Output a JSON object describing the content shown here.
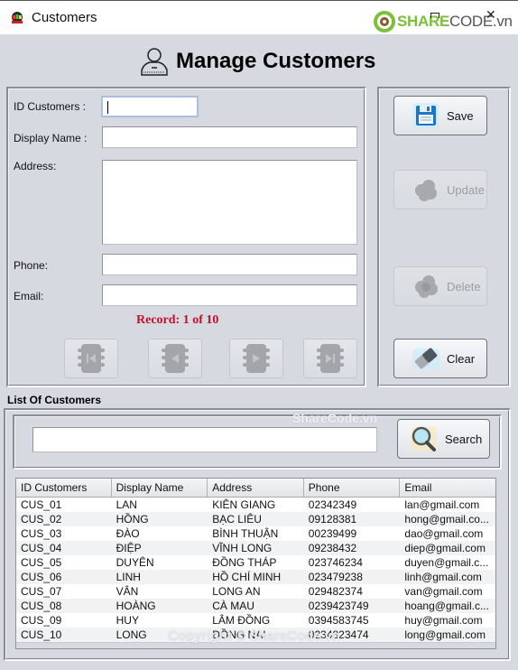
{
  "window": {
    "title": "Customers",
    "brand_share": "SHARE",
    "brand_code": "CODE.vn",
    "close_glyph": "✕"
  },
  "header": {
    "title": "Manage Customers",
    "icon": "user-icon"
  },
  "form": {
    "id_label": "ID Customers :",
    "id_value": "",
    "name_label": "Display Name :",
    "name_value": "",
    "address_label": "Address:",
    "address_value": "",
    "phone_label": "Phone:",
    "phone_value": "",
    "email_label": "Email:",
    "email_value": "",
    "record_text": "Record: 1 of 10",
    "nav": [
      {
        "name": "first",
        "icon": "first-icon"
      },
      {
        "name": "previous",
        "icon": "previous-icon"
      },
      {
        "name": "next",
        "icon": "next-icon"
      },
      {
        "name": "last",
        "icon": "last-icon"
      }
    ]
  },
  "actions": {
    "save": {
      "label": "Save",
      "enabled": true
    },
    "update": {
      "label": "Update",
      "enabled": false
    },
    "delete": {
      "label": "Delete",
      "enabled": false
    },
    "clear": {
      "label": "Clear",
      "enabled": true
    }
  },
  "list": {
    "title": "List Of Customers",
    "search_value": "",
    "search_label": "Search",
    "watermark_top": "ShareCode.vn",
    "watermark_bottom": "Copyright © ShareCode.vn",
    "columns": [
      "ID Customers",
      "Display Name",
      "Address",
      "Phone",
      "Email"
    ],
    "rows": [
      [
        "CUS_01",
        "LAN",
        "KIÊN GIANG",
        "02342349",
        "lan@gmail.com"
      ],
      [
        "CUS_02",
        "HỒNG",
        "BẠC LIÊU",
        "09128381",
        "hong@gmail.co..."
      ],
      [
        "CUS_03",
        "ĐÀO",
        "BÌNH THUẬN",
        "00239499",
        "dao@gmail.com"
      ],
      [
        "CUS_04",
        "ĐIỆP",
        " VĨNH LONG",
        "09238432",
        "diep@gmail.com"
      ],
      [
        "CUS_05",
        "DUYÊN",
        "ĐỒNG THÁP",
        "023746234",
        "duyen@gmail.c..."
      ],
      [
        "CUS_06",
        "LINH",
        "HỒ CHÍ MINH",
        "023479238",
        "linh@gmail.com"
      ],
      [
        "CUS_07",
        "VÂN",
        "LONG AN",
        "029482374",
        "van@gmail.com"
      ],
      [
        "CUS_08",
        "HOÀNG",
        "CÀ MAU",
        "0239423749",
        "hoang@gmail.c..."
      ],
      [
        "CUS_09",
        "HUY",
        "LÂM ĐỒNG",
        "0394583745",
        "huy@gmail.com"
      ],
      [
        "CUS_10",
        "LONG",
        "ĐỒNG NAI",
        "0234823474",
        "long@gmail.com"
      ]
    ]
  }
}
